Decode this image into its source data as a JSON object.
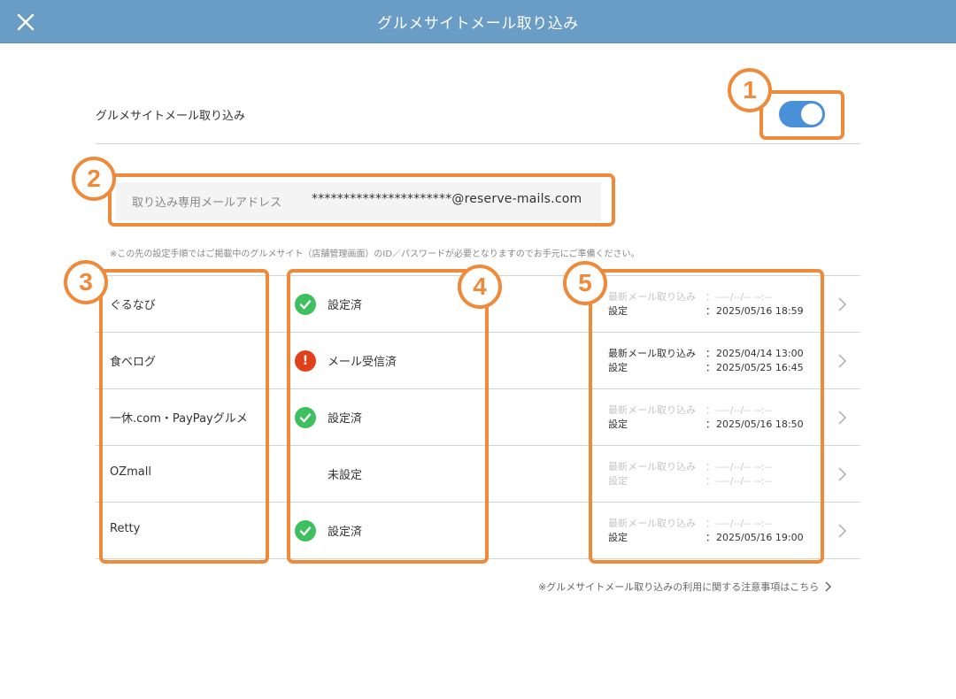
{
  "header": {
    "title": "グルメサイトメール取り込み",
    "close_icon": "close-icon"
  },
  "toggle": {
    "label": "グルメサイトメール取り込み",
    "on": true,
    "color": "#4a90d9"
  },
  "email": {
    "label": "取り込み専用メールアドレス",
    "value": "**********************@reserve-mails.com"
  },
  "notice": "※この先の設定手順ではご掲載中のグルメサイト（店舗管理画面）のID／パスワードが必要となりますのでお手元にご準備ください。",
  "sites": [
    {
      "name": "ぐるなび",
      "status": "設定済",
      "status_icon": "check-icon",
      "mail_key": "最新メール取り込み",
      "mail_value": "----/--/-- --:--",
      "set_key": "設定",
      "set_value": "2025/05/16 18:59"
    },
    {
      "name": "食べログ",
      "status": "メール受信済",
      "status_icon": "exclamation-icon",
      "mail_key": "最新メール取り込み",
      "mail_value": "2025/04/14 13:00",
      "set_key": "設定",
      "set_value": "2025/05/25 16:45"
    },
    {
      "name": "一休.com・PayPayグルメ",
      "status": "設定済",
      "status_icon": "check-icon",
      "mail_key": "最新メール取り込み",
      "mail_value": "----/--/-- --:--",
      "set_key": "設定",
      "set_value": "2025/05/16 18:50"
    },
    {
      "name": "OZmall",
      "status": "未設定",
      "status_icon": "",
      "mail_key": "最新メール取り込み",
      "mail_value": "----/--/-- --:--",
      "set_key": "設定",
      "set_value": "----/--/-- --:--"
    },
    {
      "name": "Retty",
      "status": "設定済",
      "status_icon": "check-icon",
      "mail_key": "最新メール取り込み",
      "mail_value": "----/--/-- --:--",
      "set_key": "設定",
      "set_value": "2025/05/16 19:00"
    }
  ],
  "separator": "：",
  "footer_link": "※グルメサイトメール取り込みの利用に関する注意事項はこちら",
  "annotations": [
    "1",
    "2",
    "3",
    "4",
    "5"
  ],
  "colors": {
    "header": "#6a9dc6",
    "annotation": "#ef8a3a",
    "ok": "#3fc060",
    "warn": "#e0401a"
  }
}
